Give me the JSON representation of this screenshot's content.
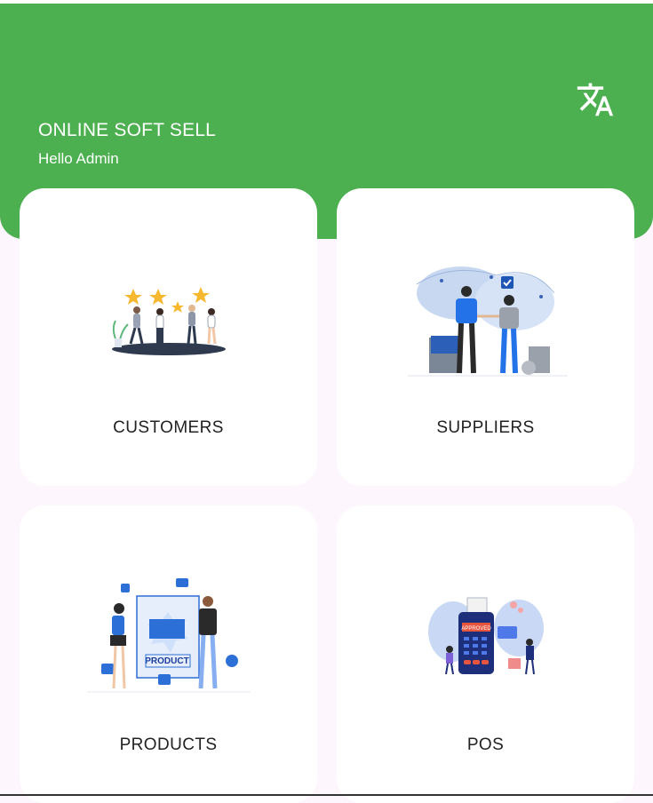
{
  "header": {
    "title": "ONLINE SOFT SELL",
    "greeting": "Hello Admin",
    "translate_icon": "translate-icon",
    "color": "#4caf50"
  },
  "cards": [
    {
      "label": "CUSTOMERS",
      "icon": "customers-illustration"
    },
    {
      "label": "SUPPLIERS",
      "icon": "suppliers-illustration"
    },
    {
      "label": "PRODUCTS",
      "icon": "products-illustration"
    },
    {
      "label": "POS",
      "icon": "pos-illustration"
    }
  ],
  "pos_illustration": {
    "receipt_text": "APPROVED"
  },
  "products_illustration": {
    "banner_text": "PRODUCT"
  }
}
